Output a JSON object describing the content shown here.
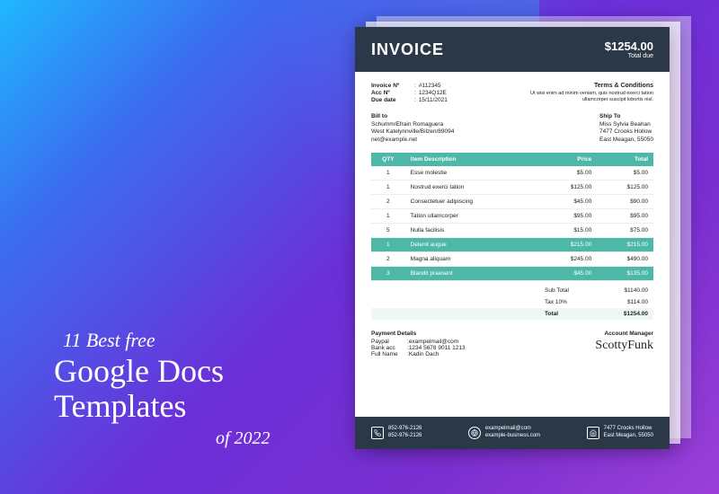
{
  "headline": {
    "l1": "11 Best free",
    "l2a": "Google Docs",
    "l2b": "Templates",
    "l3": "of 2022"
  },
  "invoice": {
    "title": "INVOICE",
    "total_due_amount": "$1254.00",
    "total_due_label": "Total due",
    "meta": {
      "invoice_no_label": "Invoice Nº",
      "invoice_no": "#112345",
      "acc_no_label": "Acc Nº",
      "acc_no": "1234Q12E",
      "due_date_label": "Due date",
      "due_date": "15/11/2021"
    },
    "terms": {
      "title": "Terms & Conditions",
      "body": "Ut wisi enim ad minim veniam, quis nostrud exerci tation ullamcorper suscipit lobortis nisl."
    },
    "bill_to": {
      "title": "Bill to",
      "line1": "Schumm/Efrain Romaguera",
      "line2": "West Katelynnville/Bilzen/89094",
      "line3": "net@example.net"
    },
    "ship_to": {
      "title": "Ship To",
      "line1": "Miss Sylvia Beahan",
      "line2": "7477 Crooks Hollow",
      "line3": "East Meagan, 55050"
    },
    "columns": {
      "qty": "QTY",
      "desc": "Item Description",
      "price": "Price",
      "total": "Total"
    },
    "items": [
      {
        "qty": "1",
        "desc": "Esse molestie",
        "price": "$5.00",
        "total": "$5.00",
        "hl": false
      },
      {
        "qty": "1",
        "desc": "Nostrud exerci tation",
        "price": "$125.00",
        "total": "$125.00",
        "hl": false
      },
      {
        "qty": "2",
        "desc": "Consectetuer adipiscing",
        "price": "$45.00",
        "total": "$90.00",
        "hl": false
      },
      {
        "qty": "1",
        "desc": "Tation ullamcorper",
        "price": "$95.00",
        "total": "$95.00",
        "hl": false
      },
      {
        "qty": "5",
        "desc": "Nulla facilisis",
        "price": "$15.00",
        "total": "$75.00",
        "hl": false
      },
      {
        "qty": "1",
        "desc": "Delenit augue",
        "price": "$215.00",
        "total": "$215.00",
        "hl": true
      },
      {
        "qty": "2",
        "desc": "Magna aliquam",
        "price": "$245.00",
        "total": "$490.00",
        "hl": false
      },
      {
        "qty": "3",
        "desc": "Blandit praesent",
        "price": "$45.00",
        "total": "$135.00",
        "hl": true
      }
    ],
    "totals": {
      "subtotal_label": "Sub Total",
      "subtotal": "$1140.00",
      "tax_label": "Tax 10%",
      "tax": "$114.00",
      "total_label": "Total",
      "total": "$1254.00"
    },
    "payment": {
      "title": "Payment Details",
      "paypal_label": "Paypal",
      "paypal": "exampelmail@com",
      "bank_label": "Bank acc",
      "bank": "1234 5678 9011 1213",
      "name_label": "Full Name",
      "name": "Kadin Dach"
    },
    "manager": {
      "title": "Account Manager",
      "signature": "ScottyFunk"
    },
    "footer": {
      "phone1": "852-976-2126",
      "phone2": "852-976-2126",
      "email": "exampelmail@com",
      "web": "example-business.com",
      "addr1": "7477 Crooks Hollow",
      "addr2": "East Meagan, 55050"
    }
  }
}
